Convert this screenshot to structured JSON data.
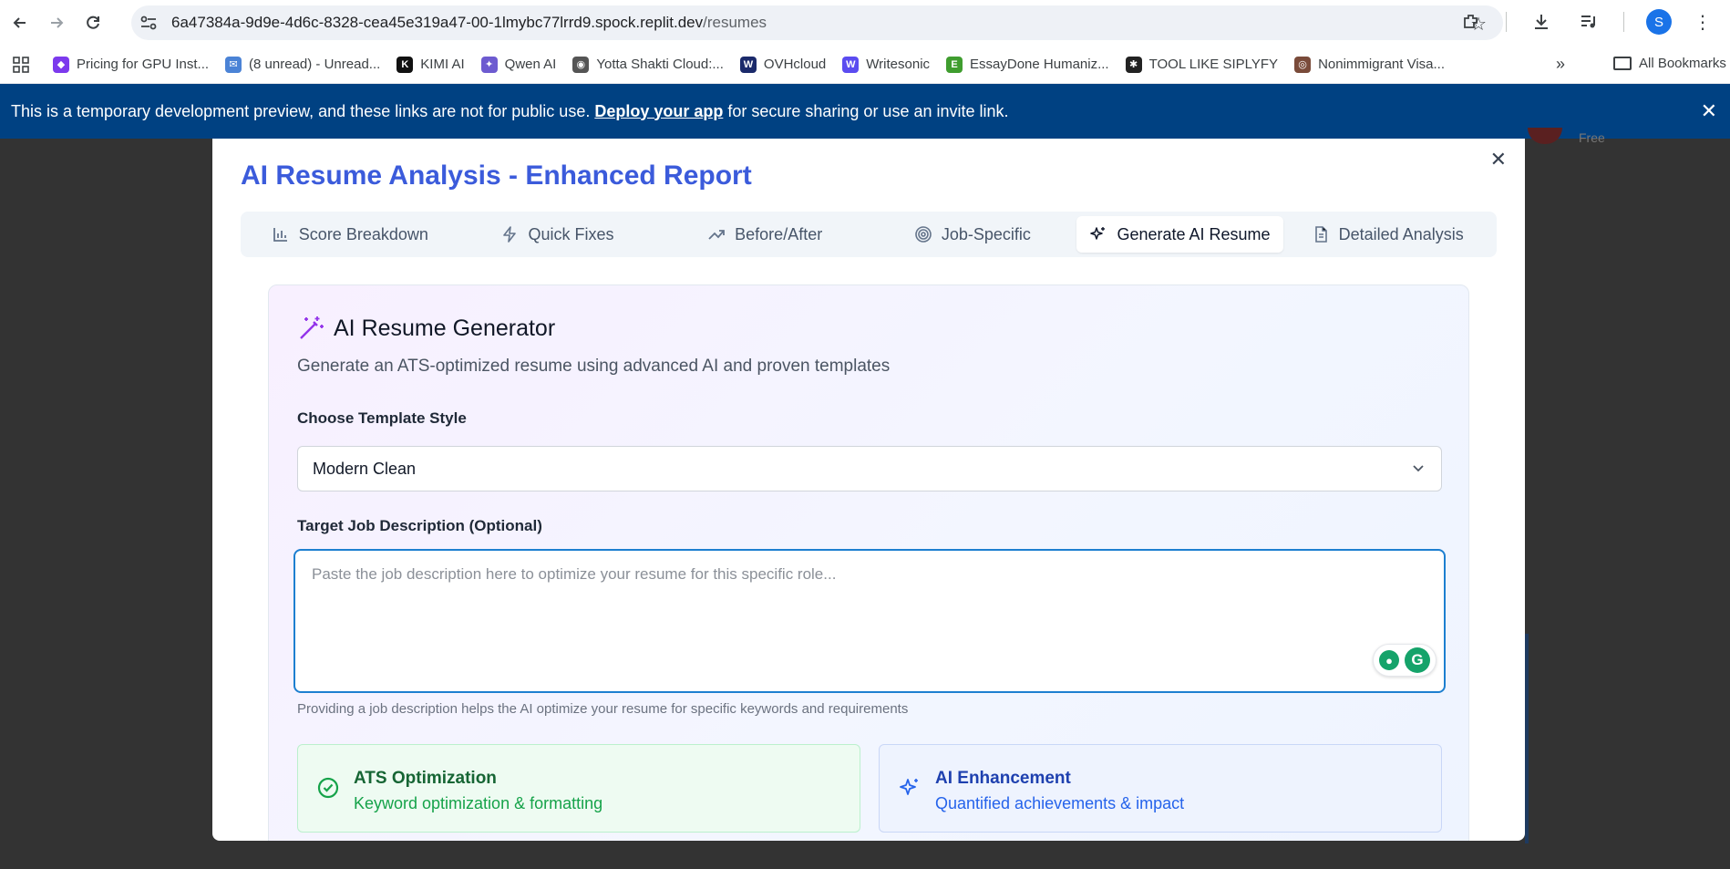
{
  "browser": {
    "url_host": "6a47384a-9d9e-4d6c-8328-cea45e319a47-00-1lmybc77lrrd9.spock.replit.dev",
    "url_path": "/resumes",
    "profile_initial": "S"
  },
  "bookmarks": {
    "items": [
      {
        "label": "Pricing for GPU Inst...",
        "color": "#7c3aed",
        "glyph": "◆"
      },
      {
        "label": "(8 unread) - Unread...",
        "color": "#4b83d6",
        "glyph": "✉"
      },
      {
        "label": "KIMI AI",
        "color": "#111111",
        "glyph": "K"
      },
      {
        "label": "Qwen AI",
        "color": "#6d5bd0",
        "glyph": "✦"
      },
      {
        "label": "Yotta Shakti Cloud:...",
        "color": "#555555",
        "glyph": "◉"
      },
      {
        "label": "OVHcloud",
        "color": "#1b2a6b",
        "glyph": "W"
      },
      {
        "label": "Writesonic",
        "color": "#5b4cf0",
        "glyph": "W"
      },
      {
        "label": "EssayDone Humaniz...",
        "color": "#3f9d2f",
        "glyph": "E"
      },
      {
        "label": "TOOL LIKE SIPLYFY",
        "color": "#222222",
        "glyph": "✱"
      },
      {
        "label": "Nonimmigrant Visa...",
        "color": "#7a4b3a",
        "glyph": "◎"
      }
    ],
    "all_bookmarks": "All Bookmarks"
  },
  "banner": {
    "text_before": "This is a temporary development preview, and these links are not for public use.",
    "link": "Deploy your app",
    "text_after": "for secure sharing or use an invite link."
  },
  "background": {
    "free_text": "Free"
  },
  "modal": {
    "title": "AI Resume Analysis - Enhanced Report",
    "tabs": [
      {
        "label": "Score Breakdown",
        "icon": "bar-chart-icon"
      },
      {
        "label": "Quick Fixes",
        "icon": "lightning-icon"
      },
      {
        "label": "Before/After",
        "icon": "trend-up-icon"
      },
      {
        "label": "Job-Specific",
        "icon": "target-icon"
      },
      {
        "label": "Generate AI Resume",
        "icon": "sparkles-icon",
        "active": true
      },
      {
        "label": "Detailed Analysis",
        "icon": "document-icon"
      }
    ]
  },
  "generator": {
    "title": "AI Resume Generator",
    "subtitle": "Generate an ATS-optimized resume using advanced AI and proven templates",
    "template_label": "Choose Template Style",
    "template_value": "Modern Clean",
    "job_label": "Target Job Description (Optional)",
    "job_placeholder": "Paste the job description here to optimize your resume for this specific role...",
    "helper": "Providing a job description helps the AI optimize your resume for specific keywords and requirements",
    "features": [
      {
        "title": "ATS Optimization",
        "desc": "Keyword optimization & formatting"
      },
      {
        "title": "AI Enhancement",
        "desc": "Quantified achievements & impact"
      }
    ]
  }
}
